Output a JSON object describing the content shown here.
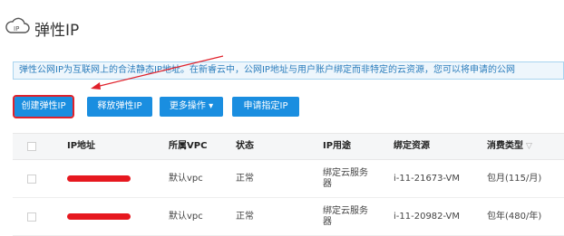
{
  "header": {
    "title": "弹性IP",
    "icon": "cloud-ip-icon"
  },
  "notice": {
    "text": "弹性公网IP为互联网上的合法静态IP地址。在新睿云中，公网IP地址与用户账户绑定而非特定的云资源，您可以将申请的公网"
  },
  "toolbar": {
    "create_label": "创建弹性IP",
    "release_label": "释放弹性IP",
    "more_label": "更多操作",
    "apply_label": "申请指定IP"
  },
  "table": {
    "columns": {
      "ip": "IP地址",
      "vpc": "所属VPC",
      "status": "状态",
      "use": "IP用途",
      "resource": "绑定资源",
      "billing": "消费类型"
    },
    "rows": [
      {
        "vpc": "默认vpc",
        "status": "正常",
        "use": "绑定云服务器",
        "resource": "i-11-21673-VM",
        "billing": "包月(115/月)"
      },
      {
        "vpc": "默认vpc",
        "status": "正常",
        "use": "绑定云服务器",
        "resource": "i-11-20982-VM",
        "billing": "包年(480/年)"
      }
    ]
  },
  "colors": {
    "accent": "#1a8ee0",
    "highlight": "#e0212b",
    "redaction": "#e6181f"
  }
}
